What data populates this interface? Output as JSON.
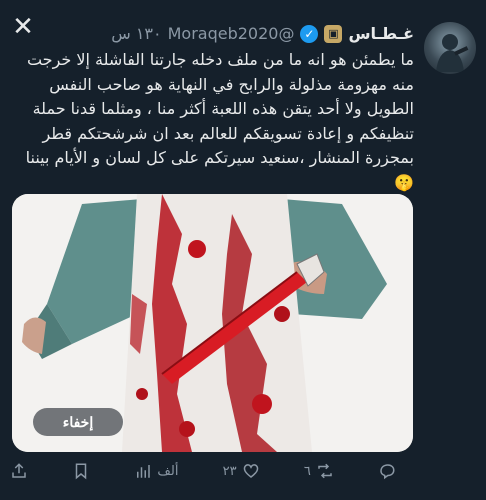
{
  "header": {
    "display_name": "غـطـاس",
    "badge_icon": "badge-icon",
    "handle": "@Moraqeb2020",
    "time": "١٣٠ س"
  },
  "tweet": {
    "lines": [
      "ما يطمئن هو انه ما من ملف دخله جارتنا الفاشلة إلا خرجت",
      "منه مهزومة مذلولة والرابح في النهاية هو صاحب النفس",
      "الطويل ولا أحد يتقن هذه اللعبة أكثر منا ، ومثلما قدنا حملة",
      "تنظيفكم و إعادة تسويقكم للعالم بعد ان شرشحتكم قطر",
      "بمجزرة المنشار ،سنعيد سيرتكم على كل لسان و الأيام بيننا",
      "🤫"
    ]
  },
  "media": {
    "hide_label": "إخفاء"
  },
  "actions": {
    "replies": "٢٣",
    "retweets": "٦",
    "likes": "",
    "views": "ألف"
  }
}
